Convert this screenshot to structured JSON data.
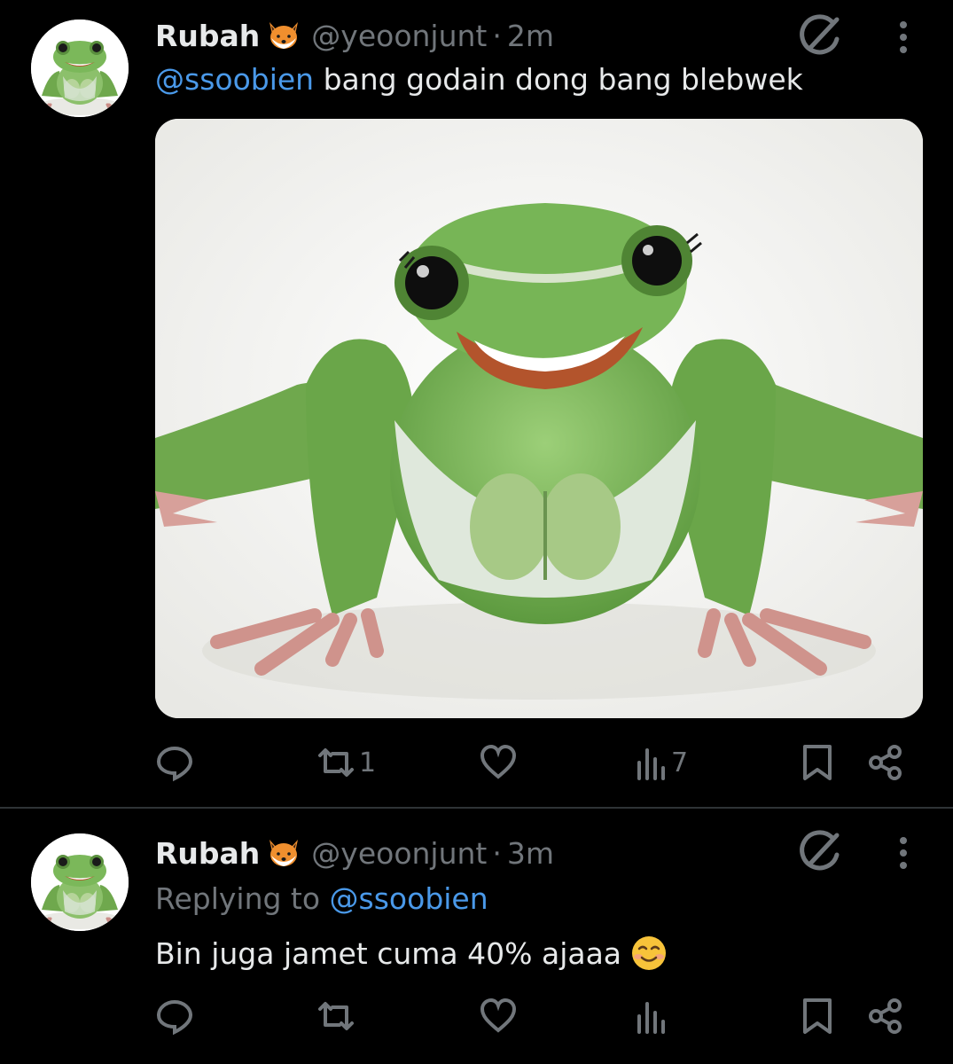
{
  "tweets": [
    {
      "display_name": "Rubah",
      "handle": "@yeoonjunt",
      "separator": "·",
      "time": "2m",
      "mention": "@ssoobien",
      "text": " bang godain dong bang blebwek",
      "stats": {
        "retweets": "1",
        "views": "7"
      }
    },
    {
      "display_name": "Rubah",
      "handle": "@yeoonjunt",
      "separator": "·",
      "time": "3m",
      "replying_prefix": "Replying to ",
      "replying_to": "@ssoobien",
      "text": "Bin juga jamet cuma 40% ajaaa",
      "stats": {
        "retweets": "",
        "views": ""
      }
    }
  ],
  "icons": [
    "frog-avatar",
    "fox-emoji",
    "grok-icon",
    "more-icon",
    "reply-icon",
    "retweet-icon",
    "like-icon",
    "views-icon",
    "bookmark-icon",
    "share-icon",
    "smiling-emoji"
  ],
  "colors": {
    "background": "#000000",
    "text": "#e7e9ea",
    "muted": "#71767b",
    "link": "#4a99e9",
    "divider": "#2f3336"
  }
}
